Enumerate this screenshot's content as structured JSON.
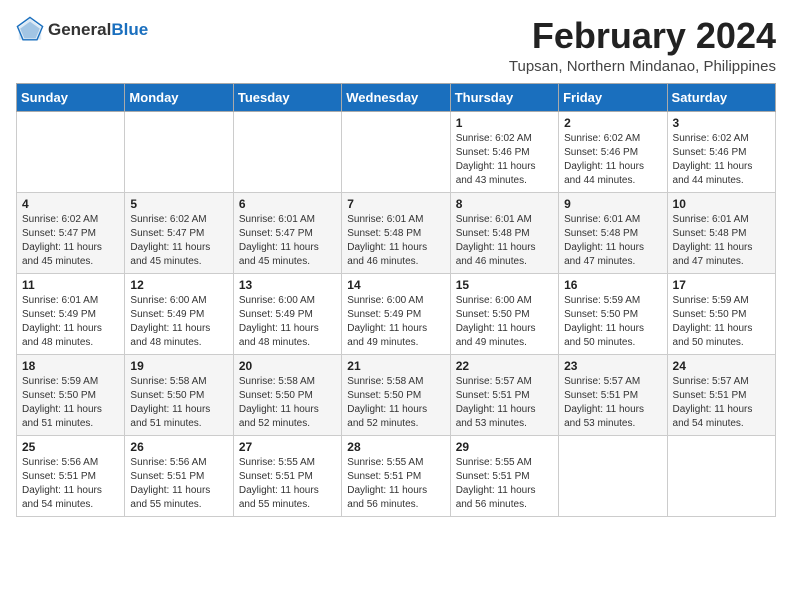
{
  "header": {
    "logo_general": "General",
    "logo_blue": "Blue",
    "month_year": "February 2024",
    "location": "Tupsan, Northern Mindanao, Philippines"
  },
  "days_of_week": [
    "Sunday",
    "Monday",
    "Tuesday",
    "Wednesday",
    "Thursday",
    "Friday",
    "Saturday"
  ],
  "weeks": [
    [
      {
        "day": "",
        "detail": ""
      },
      {
        "day": "",
        "detail": ""
      },
      {
        "day": "",
        "detail": ""
      },
      {
        "day": "",
        "detail": ""
      },
      {
        "day": "1",
        "detail": "Sunrise: 6:02 AM\nSunset: 5:46 PM\nDaylight: 11 hours\nand 43 minutes."
      },
      {
        "day": "2",
        "detail": "Sunrise: 6:02 AM\nSunset: 5:46 PM\nDaylight: 11 hours\nand 44 minutes."
      },
      {
        "day": "3",
        "detail": "Sunrise: 6:02 AM\nSunset: 5:46 PM\nDaylight: 11 hours\nand 44 minutes."
      }
    ],
    [
      {
        "day": "4",
        "detail": "Sunrise: 6:02 AM\nSunset: 5:47 PM\nDaylight: 11 hours\nand 45 minutes."
      },
      {
        "day": "5",
        "detail": "Sunrise: 6:02 AM\nSunset: 5:47 PM\nDaylight: 11 hours\nand 45 minutes."
      },
      {
        "day": "6",
        "detail": "Sunrise: 6:01 AM\nSunset: 5:47 PM\nDaylight: 11 hours\nand 45 minutes."
      },
      {
        "day": "7",
        "detail": "Sunrise: 6:01 AM\nSunset: 5:48 PM\nDaylight: 11 hours\nand 46 minutes."
      },
      {
        "day": "8",
        "detail": "Sunrise: 6:01 AM\nSunset: 5:48 PM\nDaylight: 11 hours\nand 46 minutes."
      },
      {
        "day": "9",
        "detail": "Sunrise: 6:01 AM\nSunset: 5:48 PM\nDaylight: 11 hours\nand 47 minutes."
      },
      {
        "day": "10",
        "detail": "Sunrise: 6:01 AM\nSunset: 5:48 PM\nDaylight: 11 hours\nand 47 minutes."
      }
    ],
    [
      {
        "day": "11",
        "detail": "Sunrise: 6:01 AM\nSunset: 5:49 PM\nDaylight: 11 hours\nand 48 minutes."
      },
      {
        "day": "12",
        "detail": "Sunrise: 6:00 AM\nSunset: 5:49 PM\nDaylight: 11 hours\nand 48 minutes."
      },
      {
        "day": "13",
        "detail": "Sunrise: 6:00 AM\nSunset: 5:49 PM\nDaylight: 11 hours\nand 48 minutes."
      },
      {
        "day": "14",
        "detail": "Sunrise: 6:00 AM\nSunset: 5:49 PM\nDaylight: 11 hours\nand 49 minutes."
      },
      {
        "day": "15",
        "detail": "Sunrise: 6:00 AM\nSunset: 5:50 PM\nDaylight: 11 hours\nand 49 minutes."
      },
      {
        "day": "16",
        "detail": "Sunrise: 5:59 AM\nSunset: 5:50 PM\nDaylight: 11 hours\nand 50 minutes."
      },
      {
        "day": "17",
        "detail": "Sunrise: 5:59 AM\nSunset: 5:50 PM\nDaylight: 11 hours\nand 50 minutes."
      }
    ],
    [
      {
        "day": "18",
        "detail": "Sunrise: 5:59 AM\nSunset: 5:50 PM\nDaylight: 11 hours\nand 51 minutes."
      },
      {
        "day": "19",
        "detail": "Sunrise: 5:58 AM\nSunset: 5:50 PM\nDaylight: 11 hours\nand 51 minutes."
      },
      {
        "day": "20",
        "detail": "Sunrise: 5:58 AM\nSunset: 5:50 PM\nDaylight: 11 hours\nand 52 minutes."
      },
      {
        "day": "21",
        "detail": "Sunrise: 5:58 AM\nSunset: 5:50 PM\nDaylight: 11 hours\nand 52 minutes."
      },
      {
        "day": "22",
        "detail": "Sunrise: 5:57 AM\nSunset: 5:51 PM\nDaylight: 11 hours\nand 53 minutes."
      },
      {
        "day": "23",
        "detail": "Sunrise: 5:57 AM\nSunset: 5:51 PM\nDaylight: 11 hours\nand 53 minutes."
      },
      {
        "day": "24",
        "detail": "Sunrise: 5:57 AM\nSunset: 5:51 PM\nDaylight: 11 hours\nand 54 minutes."
      }
    ],
    [
      {
        "day": "25",
        "detail": "Sunrise: 5:56 AM\nSunset: 5:51 PM\nDaylight: 11 hours\nand 54 minutes."
      },
      {
        "day": "26",
        "detail": "Sunrise: 5:56 AM\nSunset: 5:51 PM\nDaylight: 11 hours\nand 55 minutes."
      },
      {
        "day": "27",
        "detail": "Sunrise: 5:55 AM\nSunset: 5:51 PM\nDaylight: 11 hours\nand 55 minutes."
      },
      {
        "day": "28",
        "detail": "Sunrise: 5:55 AM\nSunset: 5:51 PM\nDaylight: 11 hours\nand 56 minutes."
      },
      {
        "day": "29",
        "detail": "Sunrise: 5:55 AM\nSunset: 5:51 PM\nDaylight: 11 hours\nand 56 minutes."
      },
      {
        "day": "",
        "detail": ""
      },
      {
        "day": "",
        "detail": ""
      }
    ]
  ]
}
